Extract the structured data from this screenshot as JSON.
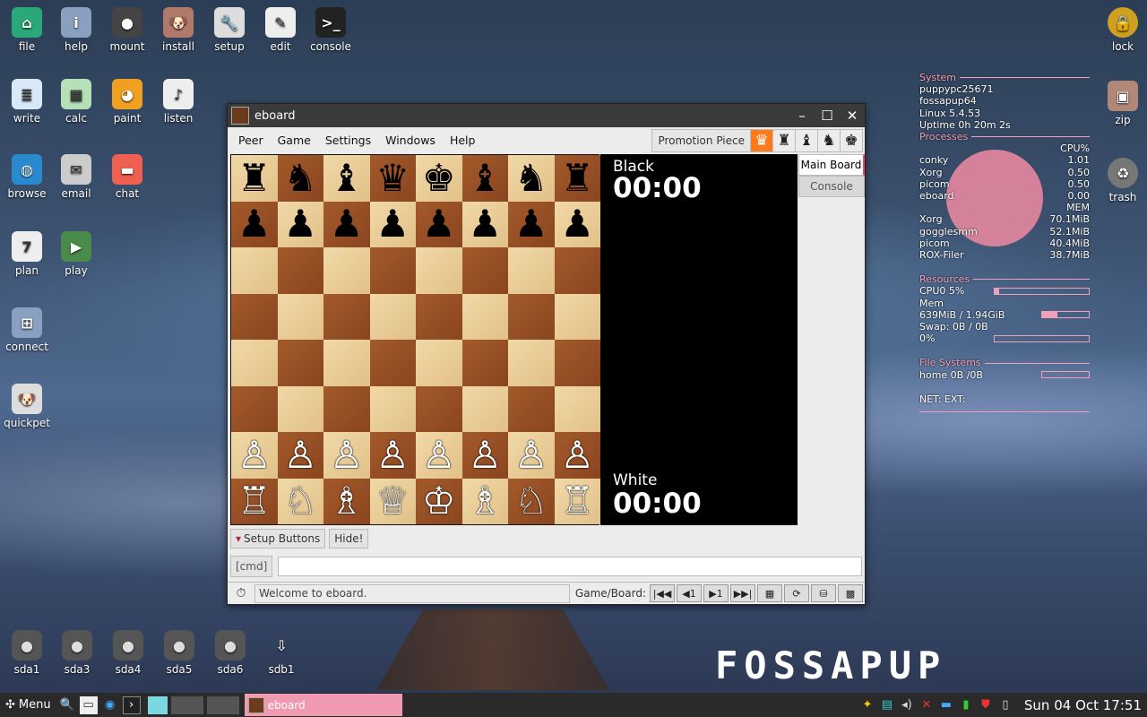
{
  "desktop_icons": [
    {
      "label": "file",
      "icon": "house-icon",
      "color": "#2aa87a"
    },
    {
      "label": "help",
      "icon": "info-icon",
      "color": "#8aa0c0"
    },
    {
      "label": "mount",
      "icon": "disk-icon",
      "color": "#444"
    },
    {
      "label": "install",
      "icon": "puppy-icon",
      "color": "#b07a6a"
    },
    {
      "label": "setup",
      "icon": "wrench-icon",
      "color": "#ddd"
    },
    {
      "label": "edit",
      "icon": "pencil-icon",
      "color": "#eee"
    },
    {
      "label": "console",
      "icon": "terminal-icon",
      "color": "#222"
    },
    {
      "label": "write",
      "icon": "doc-icon",
      "color": "#d8e8f8"
    },
    {
      "label": "calc",
      "icon": "spreadsheet-icon",
      "color": "#b8e0b8"
    },
    {
      "label": "paint",
      "icon": "palette-icon",
      "color": "#f0a020"
    },
    {
      "label": "listen",
      "icon": "music-icon",
      "color": "#eee"
    },
    {
      "label": "browse",
      "icon": "globe-icon",
      "color": "#2a8ad0"
    },
    {
      "label": "email",
      "icon": "envelope-icon",
      "color": "#ccc"
    },
    {
      "label": "chat",
      "icon": "chat-icon",
      "color": "#f06050"
    },
    {
      "label": "plan",
      "icon": "calendar-icon",
      "color": "#eee"
    },
    {
      "label": "play",
      "icon": "play-icon",
      "color": "#4a8a4a"
    },
    {
      "label": "connect",
      "icon": "network-icon",
      "color": "#8aa0c0"
    },
    {
      "label": "quickpet",
      "icon": "puppy-icon",
      "color": "#ddd"
    }
  ],
  "right_icons": [
    {
      "label": "lock",
      "icon": "padlock-icon"
    },
    {
      "label": "zip",
      "icon": "archive-icon"
    },
    {
      "label": "trash",
      "icon": "trash-icon"
    }
  ],
  "drives": [
    "sda1",
    "sda3",
    "sda4",
    "sda5",
    "sda6",
    "sdb1"
  ],
  "window": {
    "title": "eboard",
    "menu": [
      "Peer",
      "Game",
      "Settings",
      "Windows",
      "Help"
    ],
    "promotion_label": "Promotion Piece",
    "promotion_pieces": [
      "♛",
      "♜",
      "♝",
      "♞",
      "♚"
    ],
    "board_ranks": [
      [
        "♜",
        "♞",
        "♝",
        "♛",
        "♚",
        "♝",
        "♞",
        "♜"
      ],
      [
        "♟",
        "♟",
        "♟",
        "♟",
        "♟",
        "♟",
        "♟",
        "♟"
      ],
      [
        "",
        "",
        "",
        "",
        "",
        "",
        "",
        ""
      ],
      [
        "",
        "",
        "",
        "",
        "",
        "",
        "",
        ""
      ],
      [
        "",
        "",
        "",
        "",
        "",
        "",
        "",
        ""
      ],
      [
        "",
        "",
        "",
        "",
        "",
        "",
        "",
        ""
      ],
      [
        "♙",
        "♙",
        "♙",
        "♙",
        "♙",
        "♙",
        "♙",
        "♙"
      ],
      [
        "♖",
        "♘",
        "♗",
        "♕",
        "♔",
        "♗",
        "♘",
        "♖"
      ]
    ],
    "black_label": "Black",
    "black_time": "00:00",
    "white_label": "White",
    "white_time": "00:00",
    "tabs": [
      "Main Board",
      "Console"
    ],
    "setup_buttons": "Setup Buttons",
    "hide": "Hide!",
    "cmd_label": "[cmd]",
    "cmd_value": "",
    "status": "Welcome to eboard.",
    "game_board_label": "Game/Board:",
    "nav_buttons": [
      "|◀◀",
      "◀1",
      "▶1",
      "▶▶|",
      "▦",
      "⟳",
      "⛁",
      "▩"
    ]
  },
  "conky": {
    "system_header": "System",
    "hostname": "puppypc25671",
    "distro": "fossapup64",
    "kernel": "Linux 5.4.53",
    "uptime": "Uptime 0h 20m 2s",
    "processes_header": "Processes",
    "cpu_col": "CPU%",
    "cpu_procs": [
      [
        "conky",
        "1.01"
      ],
      [
        "Xorg",
        "0.50"
      ],
      [
        "picom",
        "0.50"
      ],
      [
        "eboard",
        "0.00"
      ]
    ],
    "mem_col": "MEM",
    "mem_procs": [
      [
        "Xorg",
        "70.1MiB"
      ],
      [
        "gogglesmm",
        "52.1MiB"
      ],
      [
        "picom",
        "40.4MiB"
      ],
      [
        "ROX-Filer",
        "38.7MiB"
      ]
    ],
    "resources_header": "Resources",
    "cpu0": "CPU0 5%",
    "cpu0_pct": 5,
    "mem_label": "Mem",
    "mem_value": "639MiB / 1.94GiB",
    "mem_pct": 33,
    "swap": "Swap: 0B   / 0B",
    "swap_pct_label": "0%",
    "swap_pct": 0,
    "fs_header": "File Systems",
    "home": "home 0B  /0B",
    "net": "NET: EXT:"
  },
  "taskbar": {
    "menu_label": "Menu",
    "task_label": "eboard",
    "clock": "Sun 04 Oct 17:51"
  },
  "wallpaper_text": "FOSSAPUP",
  "colors": {
    "accent": "#ef9ab0",
    "promo_selected": "#ff7a1a"
  }
}
